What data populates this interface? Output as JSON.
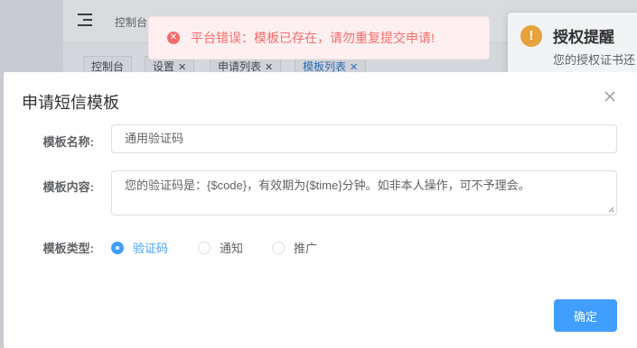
{
  "background": {
    "breadcrumb": "控制台",
    "tabs": [
      {
        "label": "控制台",
        "closable": false,
        "active": false
      },
      {
        "label": "设置",
        "closable": true,
        "active": false
      },
      {
        "label": "申请列表",
        "closable": true,
        "active": false
      },
      {
        "label": "模板列表",
        "closable": true,
        "active": true
      }
    ]
  },
  "notification": {
    "icon": "warning-icon",
    "title": "授权提醒",
    "body": "您的授权证书还"
  },
  "toast": {
    "icon": "error-circle-icon",
    "message": "平台错误：模板已存在，请勿重复提交申请!",
    "color": "#f56c6c"
  },
  "dialog": {
    "title": "申请短信模板",
    "fields": {
      "name_label": "模板名称:",
      "name_value": "通用验证码",
      "content_label": "模板内容:",
      "content_value": "您的验证码是：{$code}，有效期为{$time}分钟。如非本人操作，可不予理会。",
      "type_label": "模板类型:"
    },
    "type_options": [
      {
        "label": "验证码",
        "checked": true
      },
      {
        "label": "通知",
        "checked": false
      },
      {
        "label": "推广",
        "checked": false
      }
    ],
    "confirm_label": "确定"
  },
  "colors": {
    "primary": "#409eff",
    "danger": "#f56c6c",
    "warning": "#e6a23c"
  }
}
